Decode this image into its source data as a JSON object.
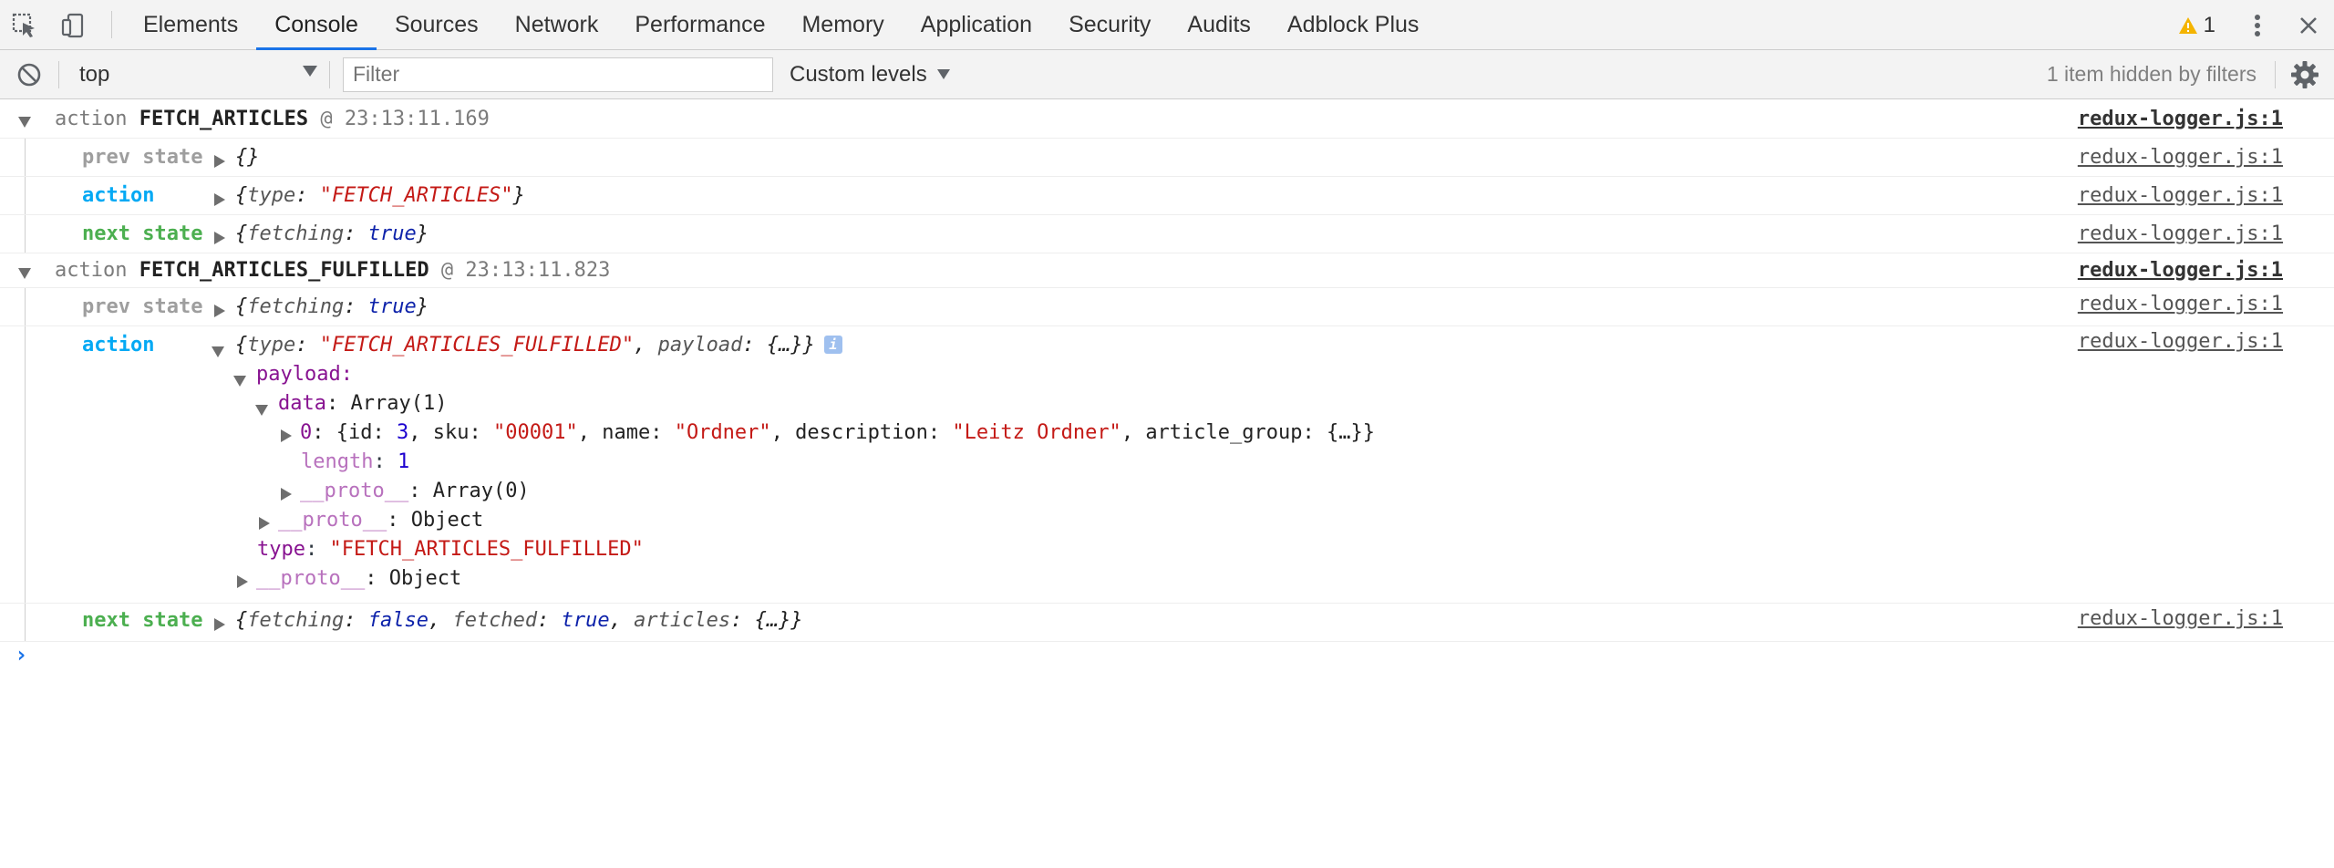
{
  "tabs": [
    "Elements",
    "Console",
    "Sources",
    "Network",
    "Performance",
    "Memory",
    "Application",
    "Security",
    "Audits",
    "Adblock Plus"
  ],
  "active_tab": "Console",
  "warnings_count": "1",
  "toolbar": {
    "context": "top",
    "filter_placeholder": "Filter",
    "levels": "Custom levels",
    "hidden_info": "1 item hidden by filters"
  },
  "source_link": "redux-logger.js:1",
  "group1": {
    "prefix": "action",
    "name": "FETCH_ARTICLES",
    "at": "@",
    "time": "23:13:11.169",
    "prev_label": "prev state",
    "prev_value": "{}",
    "action_label": "action",
    "action_key": "type",
    "action_value": "\"FETCH_ARTICLES\"",
    "next_label": "next state",
    "next_key": "fetching",
    "next_value": "true"
  },
  "group2": {
    "prefix": "action",
    "name": "FETCH_ARTICLES_FULFILLED",
    "at": "@",
    "time": "23:13:11.823",
    "prev_label": "prev state",
    "prev_key": "fetching",
    "prev_value": "true",
    "action_label": "action",
    "action_type_key": "type",
    "action_type_value": "\"FETCH_ARTICLES_FULFILLED\"",
    "action_payload_key": "payload",
    "action_payload_value": "{…}",
    "info": "i",
    "tree": {
      "payload_key": "payload",
      "data_key": "data",
      "data_value": "Array(1)",
      "item_index": "0",
      "item_id_key": "id",
      "item_id": "3",
      "item_sku_key": "sku",
      "item_sku": "\"00001\"",
      "item_name_key": "name",
      "item_name": "\"Ordner\"",
      "item_desc_key": "description",
      "item_desc": "\"Leitz Ordner\"",
      "item_group_key": "article_group",
      "item_group": "{…}",
      "length_key": "length",
      "length_value": "1",
      "proto_key": "__proto__",
      "proto_array": "Array(0)",
      "proto_object": "Object",
      "type_key": "type",
      "type_value": "\"FETCH_ARTICLES_FULFILLED\""
    },
    "next_label": "next state",
    "next_fetching_key": "fetching",
    "next_fetching": "false",
    "next_fetched_key": "fetched",
    "next_fetched": "true",
    "next_articles_key": "articles",
    "next_articles": "{…}"
  },
  "colors": {
    "active_tab_underline": "#1a73e8",
    "prev_state": "#9e9e9e",
    "action": "#03a9f4",
    "next_state": "#4caf50",
    "string": "#c41a16",
    "warning": "#f4b400"
  }
}
